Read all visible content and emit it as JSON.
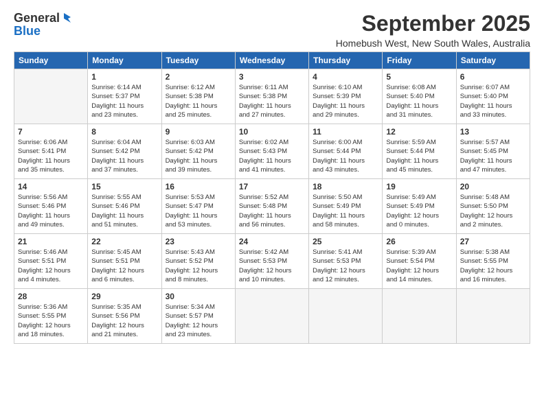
{
  "logo": {
    "line1": "General",
    "line2": "Blue"
  },
  "title": "September 2025",
  "location": "Homebush West, New South Wales, Australia",
  "days_of_week": [
    "Sunday",
    "Monday",
    "Tuesday",
    "Wednesday",
    "Thursday",
    "Friday",
    "Saturday"
  ],
  "weeks": [
    [
      {
        "day": "",
        "detail": ""
      },
      {
        "day": "1",
        "detail": "Sunrise: 6:14 AM\nSunset: 5:37 PM\nDaylight: 11 hours\nand 23 minutes."
      },
      {
        "day": "2",
        "detail": "Sunrise: 6:12 AM\nSunset: 5:38 PM\nDaylight: 11 hours\nand 25 minutes."
      },
      {
        "day": "3",
        "detail": "Sunrise: 6:11 AM\nSunset: 5:38 PM\nDaylight: 11 hours\nand 27 minutes."
      },
      {
        "day": "4",
        "detail": "Sunrise: 6:10 AM\nSunset: 5:39 PM\nDaylight: 11 hours\nand 29 minutes."
      },
      {
        "day": "5",
        "detail": "Sunrise: 6:08 AM\nSunset: 5:40 PM\nDaylight: 11 hours\nand 31 minutes."
      },
      {
        "day": "6",
        "detail": "Sunrise: 6:07 AM\nSunset: 5:40 PM\nDaylight: 11 hours\nand 33 minutes."
      }
    ],
    [
      {
        "day": "7",
        "detail": "Sunrise: 6:06 AM\nSunset: 5:41 PM\nDaylight: 11 hours\nand 35 minutes."
      },
      {
        "day": "8",
        "detail": "Sunrise: 6:04 AM\nSunset: 5:42 PM\nDaylight: 11 hours\nand 37 minutes."
      },
      {
        "day": "9",
        "detail": "Sunrise: 6:03 AM\nSunset: 5:42 PM\nDaylight: 11 hours\nand 39 minutes."
      },
      {
        "day": "10",
        "detail": "Sunrise: 6:02 AM\nSunset: 5:43 PM\nDaylight: 11 hours\nand 41 minutes."
      },
      {
        "day": "11",
        "detail": "Sunrise: 6:00 AM\nSunset: 5:44 PM\nDaylight: 11 hours\nand 43 minutes."
      },
      {
        "day": "12",
        "detail": "Sunrise: 5:59 AM\nSunset: 5:44 PM\nDaylight: 11 hours\nand 45 minutes."
      },
      {
        "day": "13",
        "detail": "Sunrise: 5:57 AM\nSunset: 5:45 PM\nDaylight: 11 hours\nand 47 minutes."
      }
    ],
    [
      {
        "day": "14",
        "detail": "Sunrise: 5:56 AM\nSunset: 5:46 PM\nDaylight: 11 hours\nand 49 minutes."
      },
      {
        "day": "15",
        "detail": "Sunrise: 5:55 AM\nSunset: 5:46 PM\nDaylight: 11 hours\nand 51 minutes."
      },
      {
        "day": "16",
        "detail": "Sunrise: 5:53 AM\nSunset: 5:47 PM\nDaylight: 11 hours\nand 53 minutes."
      },
      {
        "day": "17",
        "detail": "Sunrise: 5:52 AM\nSunset: 5:48 PM\nDaylight: 11 hours\nand 56 minutes."
      },
      {
        "day": "18",
        "detail": "Sunrise: 5:50 AM\nSunset: 5:49 PM\nDaylight: 11 hours\nand 58 minutes."
      },
      {
        "day": "19",
        "detail": "Sunrise: 5:49 AM\nSunset: 5:49 PM\nDaylight: 12 hours\nand 0 minutes."
      },
      {
        "day": "20",
        "detail": "Sunrise: 5:48 AM\nSunset: 5:50 PM\nDaylight: 12 hours\nand 2 minutes."
      }
    ],
    [
      {
        "day": "21",
        "detail": "Sunrise: 5:46 AM\nSunset: 5:51 PM\nDaylight: 12 hours\nand 4 minutes."
      },
      {
        "day": "22",
        "detail": "Sunrise: 5:45 AM\nSunset: 5:51 PM\nDaylight: 12 hours\nand 6 minutes."
      },
      {
        "day": "23",
        "detail": "Sunrise: 5:43 AM\nSunset: 5:52 PM\nDaylight: 12 hours\nand 8 minutes."
      },
      {
        "day": "24",
        "detail": "Sunrise: 5:42 AM\nSunset: 5:53 PM\nDaylight: 12 hours\nand 10 minutes."
      },
      {
        "day": "25",
        "detail": "Sunrise: 5:41 AM\nSunset: 5:53 PM\nDaylight: 12 hours\nand 12 minutes."
      },
      {
        "day": "26",
        "detail": "Sunrise: 5:39 AM\nSunset: 5:54 PM\nDaylight: 12 hours\nand 14 minutes."
      },
      {
        "day": "27",
        "detail": "Sunrise: 5:38 AM\nSunset: 5:55 PM\nDaylight: 12 hours\nand 16 minutes."
      }
    ],
    [
      {
        "day": "28",
        "detail": "Sunrise: 5:36 AM\nSunset: 5:55 PM\nDaylight: 12 hours\nand 18 minutes."
      },
      {
        "day": "29",
        "detail": "Sunrise: 5:35 AM\nSunset: 5:56 PM\nDaylight: 12 hours\nand 21 minutes."
      },
      {
        "day": "30",
        "detail": "Sunrise: 5:34 AM\nSunset: 5:57 PM\nDaylight: 12 hours\nand 23 minutes."
      },
      {
        "day": "",
        "detail": ""
      },
      {
        "day": "",
        "detail": ""
      },
      {
        "day": "",
        "detail": ""
      },
      {
        "day": "",
        "detail": ""
      }
    ]
  ]
}
